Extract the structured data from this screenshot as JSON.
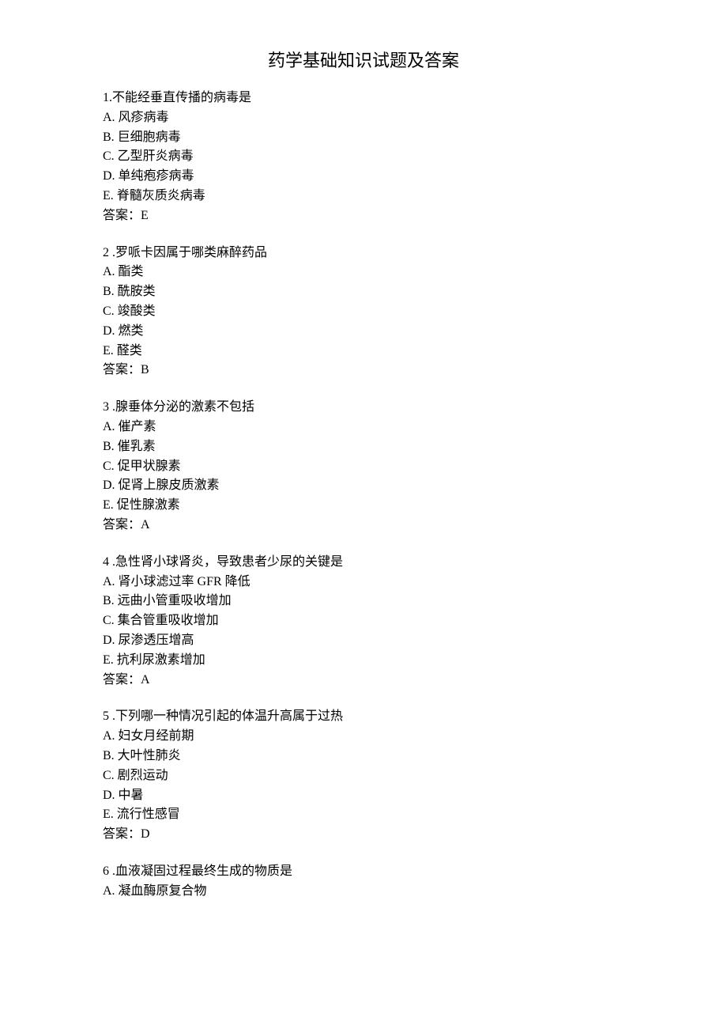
{
  "title": "药学基础知识试题及答案",
  "questions": [
    {
      "number": "1.",
      "text": "不能经垂直传播的病毒是",
      "options": [
        "A. 风疹病毒",
        "B. 巨细胞病毒",
        "C. 乙型肝炎病毒",
        "D. 单纯疱疹病毒",
        "E. 脊髓灰质炎病毒"
      ],
      "answer": "答案：E"
    },
    {
      "number": "2 .",
      "text": "罗哌卡因属于哪类麻醉药品",
      "options": [
        "A. 酯类",
        "B. 酰胺类",
        "C. 竣酸类",
        "D. 燃类",
        "E. 醛类"
      ],
      "answer": "答案：B"
    },
    {
      "number": "3 .",
      "text": "腺垂体分泌的激素不包括",
      "options": [
        "A. 催产素",
        "B. 催乳素",
        "C. 促甲状腺素",
        "D. 促肾上腺皮质激素",
        "E. 促性腺激素"
      ],
      "answer": "答案：A"
    },
    {
      "number": "4 .",
      "text": "急性肾小球肾炎，导致患者少尿的关键是",
      "options": [
        "A. 肾小球滤过率 GFR 降低",
        "B. 远曲小管重吸收增加",
        "C. 集合管重吸收增加",
        "D. 尿渗透压增高",
        "E. 抗利尿激素增加"
      ],
      "answer": "答案：A"
    },
    {
      "number": "5 .",
      "text": "下列哪一种情况引起的体温升高属于过热",
      "options": [
        "A. 妇女月经前期",
        "B. 大叶性肺炎",
        "C. 剧烈运动",
        "D. 中暑",
        "E. 流行性感冒"
      ],
      "answer": "答案：D"
    },
    {
      "number": "6 .",
      "text": "血液凝固过程最终生成的物质是",
      "options": [
        "A. 凝血酶原复合物"
      ],
      "answer": null
    }
  ]
}
